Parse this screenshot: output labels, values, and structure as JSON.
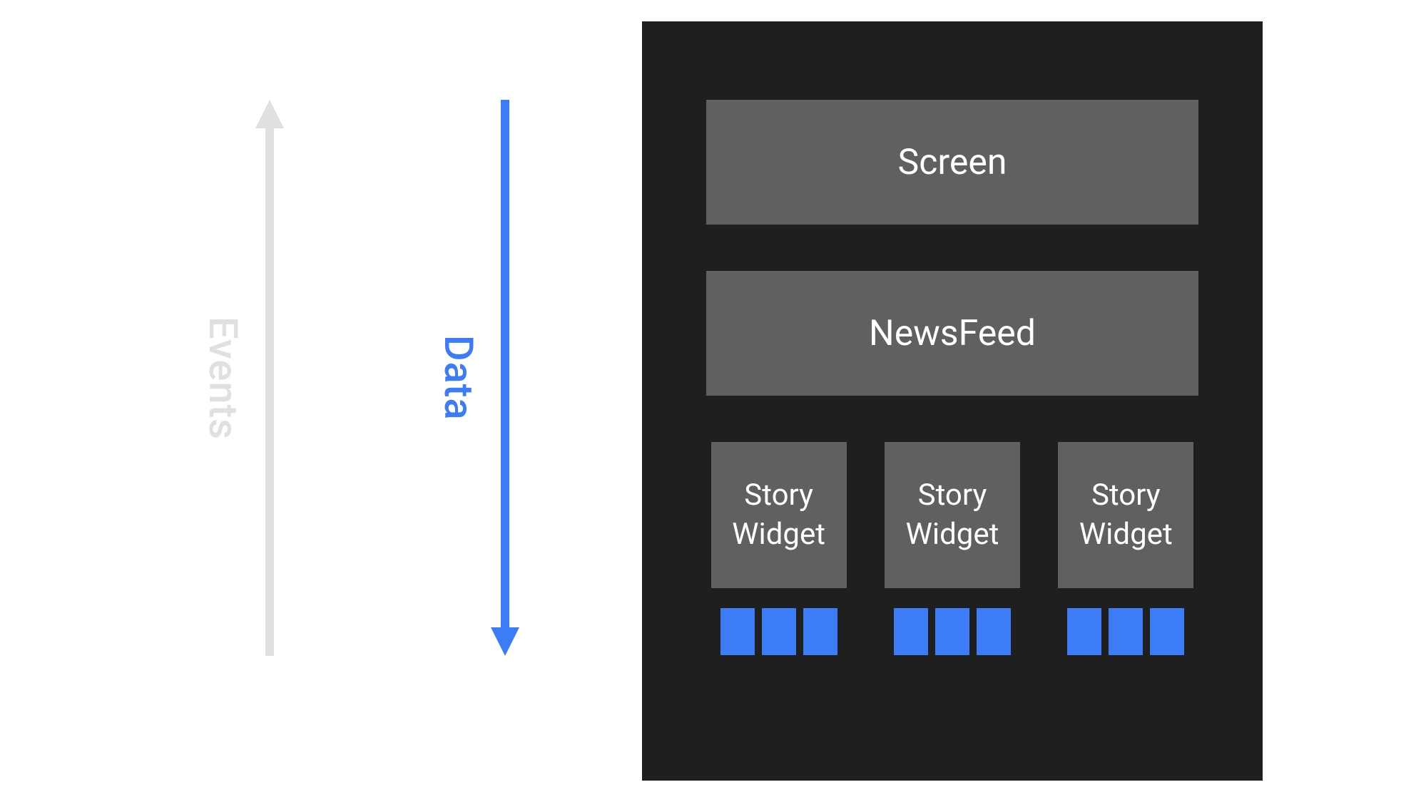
{
  "arrows": {
    "events": {
      "label": "Events",
      "direction": "up",
      "color": "#e0e0e0"
    },
    "data": {
      "label": "Data",
      "direction": "down",
      "color": "#3c7cf6"
    }
  },
  "hierarchy": {
    "screen": {
      "label": "Screen"
    },
    "newsfeed": {
      "label": "NewsFeed"
    },
    "widgets": [
      {
        "line1": "Story",
        "line2": "Widget",
        "chips": 3
      },
      {
        "line1": "Story",
        "line2": "Widget",
        "chips": 3
      },
      {
        "line1": "Story",
        "line2": "Widget",
        "chips": 3
      }
    ]
  },
  "colors": {
    "accent": "#3c7cf6",
    "muted": "#e0e0e0",
    "box": "#606060",
    "dark": "#1f1f1f"
  }
}
